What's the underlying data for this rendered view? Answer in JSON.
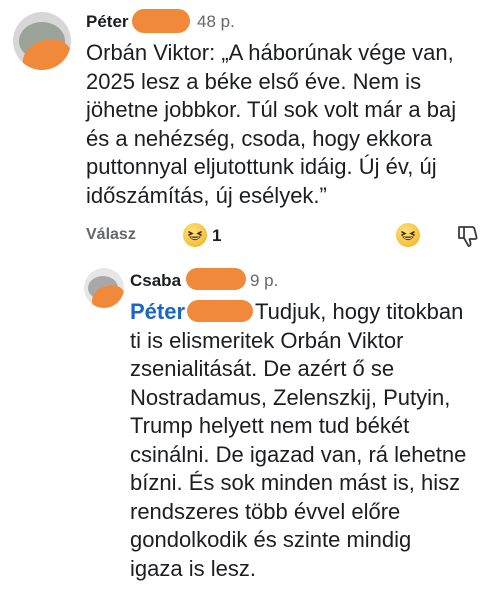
{
  "comment": {
    "author": "Péter",
    "time": "48 p.",
    "lines": [
      "Orbán Viktor: „A háborúnak vége van,",
      "2025 lesz a béke első éve. Nem is",
      "jöhetne jobbkor. Túl sok volt már a baj",
      "és a nehézség, csoda, hogy ekkora",
      "puttonnyal eljutottunk idáig. Új év, új",
      "időszámítás, új esélyek.”"
    ],
    "reply_label": "Válasz",
    "reaction_count": "1",
    "reaction_icon": "laughing-emoji"
  },
  "reply": {
    "author": "Csaba",
    "time": "9 p.",
    "mention": "Péter",
    "first_line_rest": "Tudjuk, hogy titokban",
    "lines": [
      "ti is elismeritek Orbán Viktor",
      "zsenialitását. De azért ő se",
      "Nostradamus, Zelenszkij, Putyin,",
      "Trump helyett nem tud békét",
      "csinálni. De igazad van, rá lehetne",
      "bízni. És sok minden mást is, hisz",
      "rendszeres több évvel előre",
      "gondolkodik és szinte mindig",
      "igaza is lesz."
    ]
  }
}
